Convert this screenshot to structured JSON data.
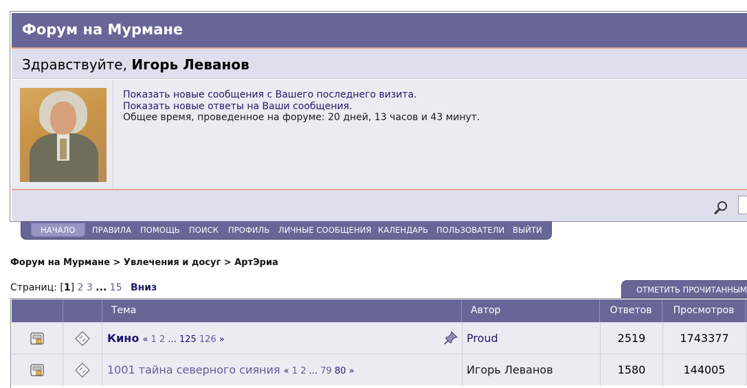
{
  "forum": {
    "title": "Форум на Мурмане",
    "greeting_prefix": "Здравствуйте,",
    "user_name": "Игорь Леванов",
    "links": {
      "new_since_last": "Показать новые сообщения с Вашего последнего визита.",
      "new_replies": "Показать новые ответы на Ваши сообщения.",
      "time_spent": "Общее время, проведенное на форуме: 20 дней, 13 часов и 43 минут."
    }
  },
  "nav": {
    "items": [
      "НАЧАЛО",
      "ПРАВИЛА",
      "ПОМОЩЬ",
      "ПОИСК",
      "ПРОФИЛЬ",
      "ЛИЧНЫЕ СООБЩЕНИЯ",
      "КАЛЕНДАРЬ",
      "ПОЛЬЗОВАТЕЛИ",
      "ВЫЙТИ"
    ]
  },
  "breadcrumb": {
    "root": "Форум на Мурмане",
    "sep": ">",
    "section": "Увлечения и досуг",
    "forum": "АртЭриа"
  },
  "pager": {
    "label": "Страниц:",
    "current": "1",
    "p2": "2",
    "p3": "3",
    "ellipsis": "...",
    "last": "15",
    "down": "Вниз"
  },
  "actions": {
    "mark_read": "ОТМЕТИТЬ ПРОЧИТАННЫМИ"
  },
  "table": {
    "headers": {
      "topic": "Тема",
      "author": "Автор",
      "replies": "Ответов",
      "views": "Просмотров"
    },
    "rows": [
      {
        "title": "Кино",
        "pages": {
          "open": "«",
          "p1": "1",
          "p2": "2",
          "dots": "...",
          "p3": "125",
          "p4": "126",
          "close": "»"
        },
        "author": "Proud",
        "replies": "2519",
        "views": "1743377"
      },
      {
        "title": "1001 тайна северного сияния",
        "pages": {
          "open": "«",
          "p1": "1",
          "p2": "2",
          "dots": "...",
          "p3": "79",
          "p4": "80",
          "close": "»"
        },
        "author": "Игорь Леванов",
        "replies": "1580",
        "views": "144005"
      }
    ]
  },
  "colors": {
    "header_bg": "#676697",
    "panel_bg": "#dedfec",
    "row_bg": "#ebebf2",
    "accent_line": "#e8a38b",
    "link": "#1d1a6a"
  }
}
